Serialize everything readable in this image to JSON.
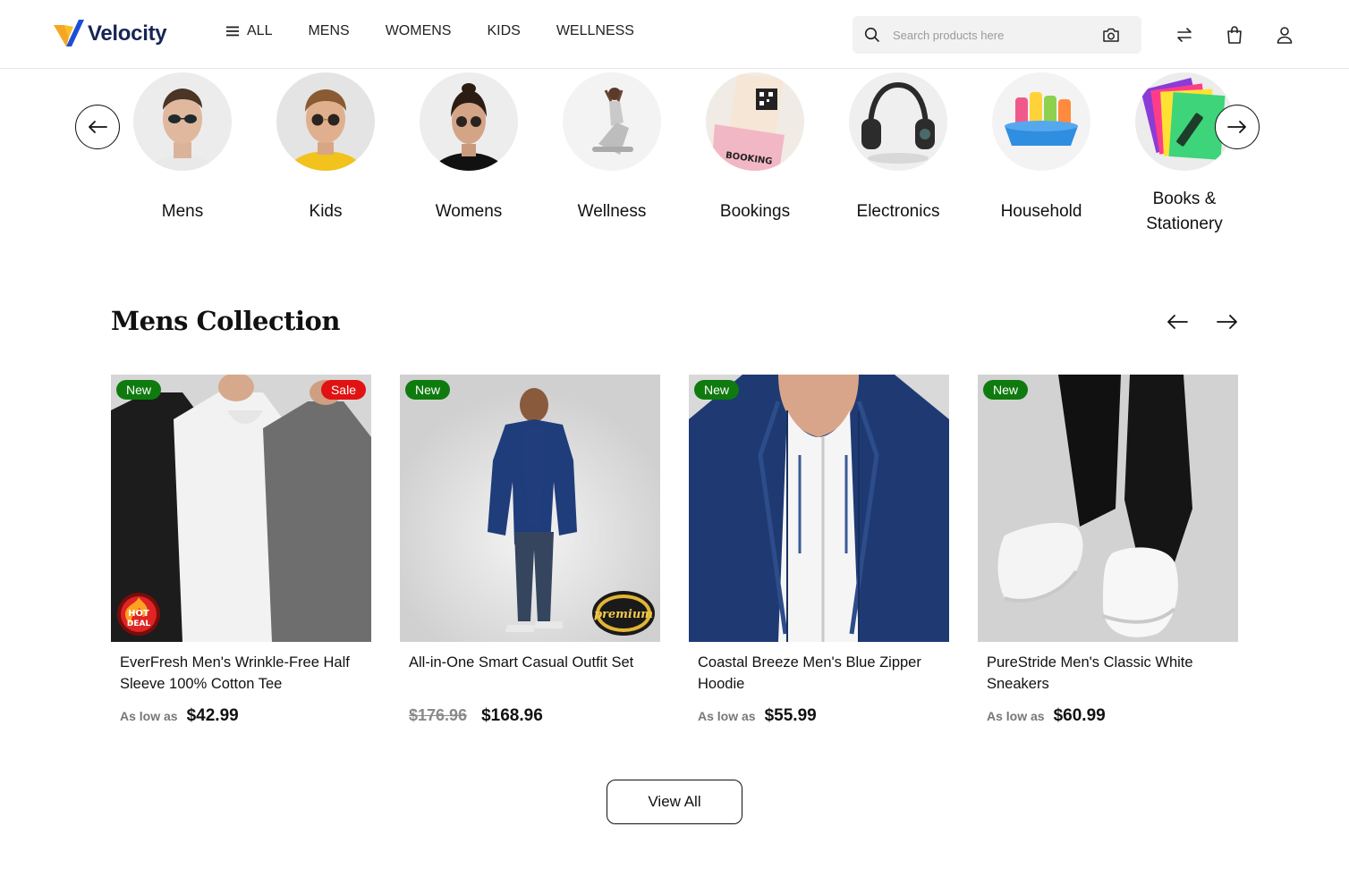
{
  "brand": {
    "name": "Velocity",
    "accent": "#f5a623",
    "navy": "#172554"
  },
  "nav": [
    {
      "label": "ALL",
      "icon": "menu-icon"
    },
    {
      "label": "MENS"
    },
    {
      "label": "WOMENS"
    },
    {
      "label": "KIDS"
    },
    {
      "label": "WELLNESS"
    }
  ],
  "search": {
    "placeholder": "Search products here"
  },
  "header_icons": [
    "compare-icon",
    "shopping-bag-icon",
    "user-icon"
  ],
  "categories": [
    {
      "label": "Mens"
    },
    {
      "label": "Kids"
    },
    {
      "label": "Womens"
    },
    {
      "label": "Wellness"
    },
    {
      "label": "Bookings",
      "image_text": "BOOKING"
    },
    {
      "label": "Electronics"
    },
    {
      "label": "Household"
    },
    {
      "label": "Books & Stationery"
    }
  ],
  "section": {
    "title": "Mens Collection"
  },
  "products": [
    {
      "name": "EverFresh Men's Wrinkle-Free Half Sleeve 100% Cotton Tee",
      "badge_new": "New",
      "badge_sale": "Sale",
      "corner_badge": "HOT DEAL",
      "as_low": "As low as",
      "price": "$42.99"
    },
    {
      "name": "All-in-One Smart Casual Outfit Set",
      "badge_new": "New",
      "corner_badge": "premium",
      "old_price": "$176.96",
      "price": "$168.96"
    },
    {
      "name": "Coastal Breeze Men's Blue Zipper Hoodie",
      "badge_new": "New",
      "as_low": "As low as",
      "price": "$55.99"
    },
    {
      "name": "PureStride Men's Classic White Sneakers",
      "badge_new": "New",
      "as_low": "As low as",
      "price": "$60.99"
    }
  ],
  "view_all": "View All",
  "colors": {
    "new_badge": "#0f7b0f",
    "sale_badge": "#e11212"
  }
}
